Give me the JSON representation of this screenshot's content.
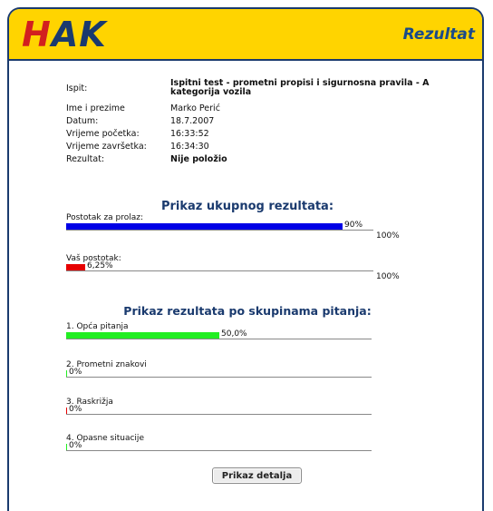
{
  "header": {
    "logo": "HAK",
    "title": "Rezultat"
  },
  "info": [
    {
      "label": "Ispit:",
      "value": "Ispitni test - prometni propisi i sigurnosna pravila - A kategorija vozila",
      "bold": true
    },
    {
      "label": "Ime i prezime",
      "value": "Marko Perić",
      "bold": false
    },
    {
      "label": "Datum:",
      "value": "18.7.2007",
      "bold": false
    },
    {
      "label": "Vrijeme početka:",
      "value": "16:33:52",
      "bold": false
    },
    {
      "label": "Vrijeme završetka:",
      "value": "16:34:30",
      "bold": false
    },
    {
      "label": "Rezultat:",
      "value": "Nije položio",
      "bold": true
    }
  ],
  "overall": {
    "title": "Prikaz ukupnog rezultata:",
    "pass": {
      "label": "Postotak za prolaz:",
      "value": 90,
      "text": "90%",
      "max": "100%",
      "color": "#0000e6"
    },
    "yours": {
      "label": "Vaš postotak:",
      "value": 6.25,
      "text": "6,25%",
      "max": "100%",
      "color": "#e60000"
    }
  },
  "groups_title": "Prikaz rezultata po skupinama pitanja:",
  "groups": [
    {
      "label": "1. Opća pitanja",
      "value": 50,
      "text": "50,0%",
      "color": "#22ee22"
    },
    {
      "label": "2. Prometni znakovi",
      "value": 0,
      "text": "0%",
      "color": "#22ee22"
    },
    {
      "label": "3. Raskrižja",
      "value": 0,
      "text": "0%",
      "color": "#e60000"
    },
    {
      "label": "4. Opasne situacije",
      "value": 0,
      "text": "0%",
      "color": "#22ee22"
    }
  ],
  "details_button": "Prikaz detalja"
}
